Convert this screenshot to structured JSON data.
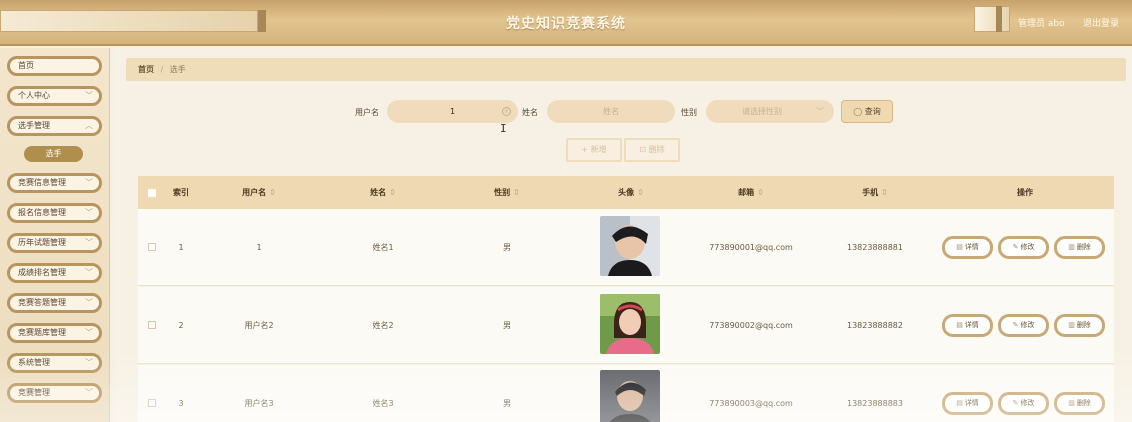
{
  "header": {
    "title": "党史知识竞赛系统",
    "user_label": "管理员 abo",
    "logout_label": "退出登录"
  },
  "sidebar": {
    "items": [
      {
        "label": "首页"
      },
      {
        "label": "个人中心",
        "icon": "chevron-down-icon"
      },
      {
        "label": "选手管理",
        "icon": "chevron-up-icon"
      },
      {
        "label": "竞赛信息管理",
        "icon": "chevron-down-icon"
      },
      {
        "label": "报名信息管理",
        "icon": "chevron-down-icon"
      },
      {
        "label": "历年试题管理",
        "icon": "chevron-down-icon"
      },
      {
        "label": "成绩排名管理",
        "icon": "chevron-down-icon"
      },
      {
        "label": "竞赛答题管理",
        "icon": "chevron-down-icon"
      },
      {
        "label": "竞赛题库管理",
        "icon": "chevron-down-icon"
      },
      {
        "label": "系统管理",
        "icon": "chevron-down-icon"
      },
      {
        "label": "竞赛管理",
        "icon": "chevron-down-icon"
      }
    ],
    "active_sub": "选手"
  },
  "breadcrumb": {
    "home": "首页",
    "separator": "/",
    "current": "选手"
  },
  "search": {
    "username_label": "用户名",
    "username_value": "1",
    "name_label": "姓名",
    "name_placeholder": "姓名",
    "gender_label": "性别",
    "gender_placeholder": "请选择性别",
    "search_button": "查询"
  },
  "actions": {
    "add_button": "+ 新增",
    "delete_button": "删除"
  },
  "table": {
    "columns": [
      "索引",
      "用户名",
      "姓名",
      "性别",
      "头像",
      "邮箱",
      "手机",
      "操作"
    ],
    "sort_marker": "⇕",
    "rows": [
      {
        "index": "1",
        "username": "1",
        "name": "姓名1",
        "gender": "男",
        "email": "773890001@qq.com",
        "phone": "13823888881"
      },
      {
        "index": "2",
        "username": "用户名2",
        "name": "姓名2",
        "gender": "男",
        "email": "773890002@qq.com",
        "phone": "13823888882"
      },
      {
        "index": "3",
        "username": "用户名3",
        "name": "姓名3",
        "gender": "男",
        "email": "773890003@qq.com",
        "phone": "13823888883"
      }
    ],
    "row_actions": {
      "detail": "详情",
      "edit": "修改",
      "delete": "删除"
    }
  },
  "colors": {
    "accent": "#b8955e",
    "header": "#d4b37d",
    "table_head": "#efd9b3"
  }
}
